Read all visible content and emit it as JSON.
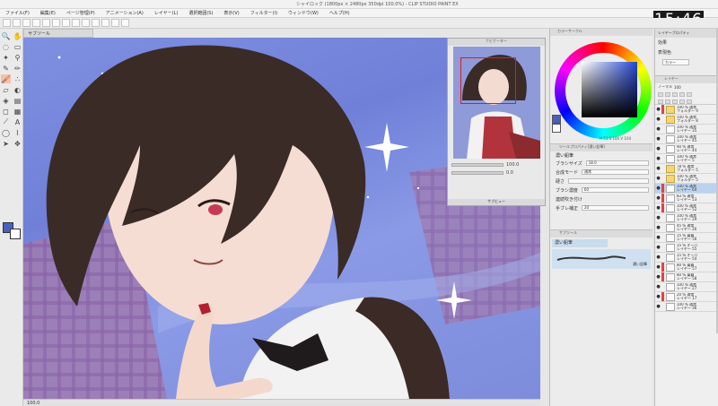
{
  "window": {
    "title": "シャイロック (1800px × 2480px 350dpi 100.0%) - CLIP STUDIO PAINT EX"
  },
  "clock": "15:46",
  "menu": [
    "ファイル(F)",
    "編集(E)",
    "ページ管理(P)",
    "アニメーション(A)",
    "レイヤー(L)",
    "選択範囲(S)",
    "表示(V)",
    "フィルター(I)",
    "ウィンドウ(W)",
    "ヘルプ(H)"
  ],
  "subtool": {
    "title": "サブツール"
  },
  "navigator": {
    "title": "ナビゲーター",
    "zoom": "100.0",
    "rotate": "0.0",
    "footer": "サブビュー"
  },
  "color_panel": {
    "title": "カラーサークル",
    "h": "H 51",
    "s": "S 100",
    "v": "V 104",
    "colors": {
      "main": "#4860c0",
      "sub": "#ffffff"
    }
  },
  "tool_property": {
    "title": "ツールプロパティ[濃い鉛筆]",
    "tool_name": "濃い鉛筆",
    "rows": [
      {
        "label": "ブラシサイズ",
        "value": "18.0"
      },
      {
        "label": "合成モード",
        "value": "通常"
      },
      {
        "label": "硬さ",
        "value": ""
      },
      {
        "label": "ブラシ濃度",
        "value": "60"
      },
      {
        "label": "連続吹き付け",
        "value": ""
      },
      {
        "label": "手ブレ補正",
        "value": "20"
      }
    ]
  },
  "brush_panel": {
    "title": "サブツール",
    "selected": "濃い鉛筆",
    "brush_label": "濃い鉛筆"
  },
  "right_property": {
    "title": "レイヤープロパティ",
    "effect_label": "効果",
    "color_label": "表現色",
    "color_value": "カラー"
  },
  "layer_panel": {
    "title": "レイヤー",
    "blend": "ノーマル",
    "opacity": "100",
    "layers": [
      {
        "name": "100 % 通常\nフォルダー 9",
        "kind": "folder",
        "mark": "#d44"
      },
      {
        "name": "100 % 通常\nフォルダー 8",
        "kind": "folder",
        "mark": ""
      },
      {
        "name": "100 % 通常\nレイヤー 35",
        "kind": "layer",
        "mark": ""
      },
      {
        "name": "100 % 通常\nレイヤー 45",
        "kind": "layer",
        "mark": ""
      },
      {
        "name": "90 % 通常\nレイヤー 44",
        "kind": "layer",
        "mark": ""
      },
      {
        "name": "100 % 通常\nレイヤー 5",
        "kind": "layer",
        "mark": ""
      },
      {
        "name": "78 % 通常\nフォルダー 5",
        "kind": "folder",
        "mark": ""
      },
      {
        "name": "100 % 通常\nフォルダー 5",
        "kind": "folder",
        "mark": ""
      },
      {
        "name": "100 % 通常\nレイヤー 64",
        "kind": "layer",
        "mark": "#d44",
        "selected": true
      },
      {
        "name": "83 % 通常\nレイヤー 53",
        "kind": "layer",
        "mark": "#d44"
      },
      {
        "name": "100 % 通常\nレイヤー 52",
        "kind": "layer",
        "mark": "#d44"
      },
      {
        "name": "100 % 通常\nレイヤー 29",
        "kind": "layer",
        "mark": ""
      },
      {
        "name": "45 % 通常\nレイヤー 26",
        "kind": "layer",
        "mark": ""
      },
      {
        "name": "15 % 乗算\nレイヤー 56",
        "kind": "layer",
        "mark": ""
      },
      {
        "name": "15 % オーバ\nレイヤー 55",
        "kind": "layer",
        "mark": ""
      },
      {
        "name": "15 % オーバ\nレイヤー 54",
        "kind": "layer",
        "mark": ""
      },
      {
        "name": "80 % 乗算\nレイヤー 57",
        "kind": "layer",
        "mark": "#d44"
      },
      {
        "name": "80 % 乗算\nレイヤー 58",
        "kind": "layer",
        "mark": "#d44"
      },
      {
        "name": "100 % 通常\nレイヤー 27",
        "kind": "layer",
        "mark": ""
      },
      {
        "name": "20 % 通常\nレイヤー 17",
        "kind": "layer",
        "mark": "#d44"
      },
      {
        "name": "100 % 通常\nレイヤー 36",
        "kind": "layer",
        "mark": ""
      }
    ]
  },
  "status": {
    "zoom": "100.0"
  }
}
